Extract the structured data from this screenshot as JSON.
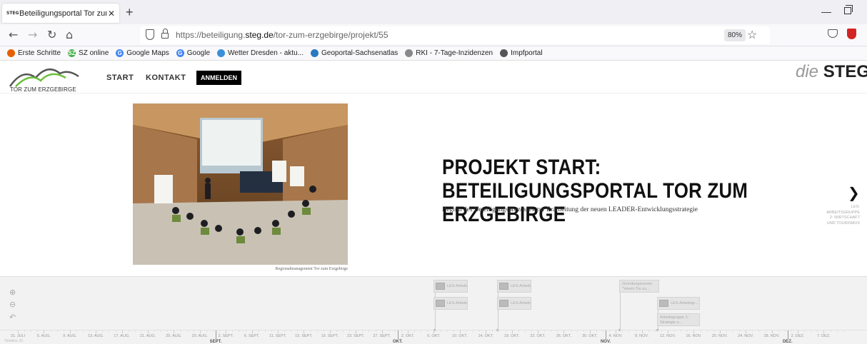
{
  "browser": {
    "tab_title": "Beteiligungsportal Tor zum Erzg",
    "tab_favicon": "STEG",
    "new_tab": "+",
    "url_prefix": "https://beteiligung.",
    "url_domain": "steg.de",
    "url_path": "/tor-zum-erzgebirge/projekt/55",
    "zoom": "80%"
  },
  "bookmarks": [
    {
      "label": "Erste Schritte",
      "color": "#e66000",
      "glyph": ""
    },
    {
      "label": "SZ online",
      "color": "#4caf50",
      "glyph": "SZ"
    },
    {
      "label": "Google Maps",
      "color": "#4285f4",
      "glyph": "G"
    },
    {
      "label": "Google",
      "color": "#4285f4",
      "glyph": "G"
    },
    {
      "label": "Wetter Dresden - aktu...",
      "color": "#3a8fd8",
      "glyph": ""
    },
    {
      "label": "Geoportal-Sachsenatlas",
      "color": "#2a7ac0",
      "glyph": ""
    },
    {
      "label": "RKI - 7-Tage-Inzidenzen",
      "color": "#888888",
      "glyph": ""
    },
    {
      "label": "Impfportal",
      "color": "#555555",
      "glyph": ""
    }
  ],
  "site": {
    "logo_text": "TOR ZUM ERZGEBIRGE",
    "menu": [
      "START",
      "KONTAKT"
    ],
    "login": "ANMELDEN",
    "brand_die": "die",
    "brand_steg": "STEG"
  },
  "slide": {
    "headline": "PROJEKT START: BETEILIGUNGSPORTAL TOR ZUM ERZGEBIRGE",
    "subline": "Beginn des Beteiligungsprozesses zur Erarbeitung der neuen LEADER-Entwicklungsstrategie",
    "photo_caption": "Regionalmanagement Tor zum Erzgebirge",
    "next_arrow": "❯",
    "next_label": "LES-ARBEITSGRUPPE 2: WIRTSCHAFT UND TOURISMUS"
  },
  "timeline": {
    "tools": [
      "⊕",
      "⊖",
      "↶"
    ],
    "markers": [
      {
        "text": "LES-Arbeitsgr..."
      },
      {
        "text": "LES-Arbeitsgr..."
      },
      {
        "text": "LES-Arbeitsgr..."
      },
      {
        "text": "LES-Arbeitsgr..."
      },
      {
        "text": "LES-Arbeitsgr..."
      }
    ],
    "text_markers": [
      {
        "text": "Gründungsverein \"Verein Tor zu..."
      },
      {
        "text": "Arbeitsgruppe 1: Strategie u..."
      }
    ],
    "day_labels": [
      "31. JULI",
      "5. AUG.",
      "9. AUG.",
      "13. AUG.",
      "17. AUG.",
      "21. AUG.",
      "25. AUG.",
      "29. AUG.",
      "2. SEPT.",
      "6. SEPT.",
      "11. SEPT.",
      "15. SEPT.",
      "19. SEPT.",
      "23. SEPT.",
      "27. SEPT.",
      "2. OKT.",
      "6. OKT.",
      "10. OKT.",
      "14. OKT.",
      "18. OKT.",
      "22. OKT.",
      "26. OKT.",
      "30. OKT.",
      "4. NOV.",
      "8. NOV.",
      "12. NOV.",
      "16. NOV.",
      "20. NOV.",
      "24. NOV.",
      "28. NOV.",
      "2. DEZ.",
      "7. DEZ."
    ],
    "months": [
      "SEPT.",
      "OKT.",
      "NOV.",
      "DEZ."
    ],
    "credit": "Timeline JS"
  }
}
